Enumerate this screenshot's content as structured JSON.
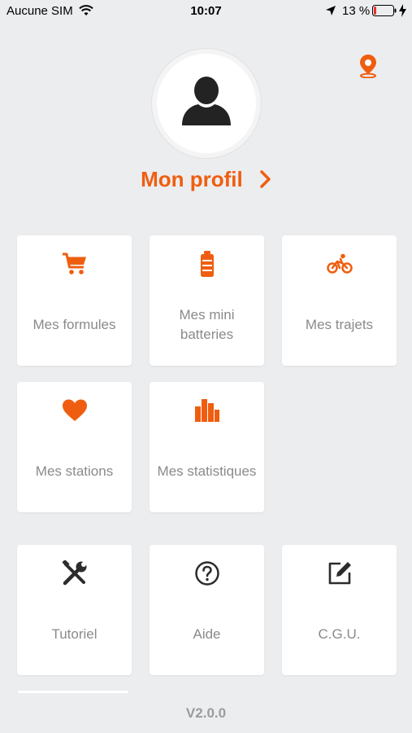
{
  "status_bar": {
    "carrier": "Aucune SIM",
    "time": "10:07",
    "battery_percent": "13 %",
    "battery_level": 0.13
  },
  "header": {
    "map_icon": "map-pin-icon",
    "avatar_icon": "user-silhouette-icon",
    "profile_label": "Mon profil"
  },
  "colors": {
    "accent": "#ef5e10",
    "background": "#ecedef",
    "tile": "#ffffff",
    "label": "#8a8a8a",
    "dark_icon": "#2c2c2c"
  },
  "menu": [
    {
      "label": "Mes formules",
      "icon": "cart-icon"
    },
    {
      "label": "Mes mini batteries",
      "icon": "battery-icon"
    },
    {
      "label": "Mes trajets",
      "icon": "bicycle-icon"
    },
    {
      "label": "Mes stations",
      "icon": "heart-icon"
    },
    {
      "label": "Mes statistiques",
      "icon": "bar-chart-icon"
    }
  ],
  "secondary_menu": [
    {
      "label": "Tutoriel",
      "icon": "tools-icon"
    },
    {
      "label": "Aide",
      "icon": "help-icon"
    },
    {
      "label": "C.G.U.",
      "icon": "edit-icon"
    }
  ],
  "footer": {
    "version": "V2.0.0"
  }
}
